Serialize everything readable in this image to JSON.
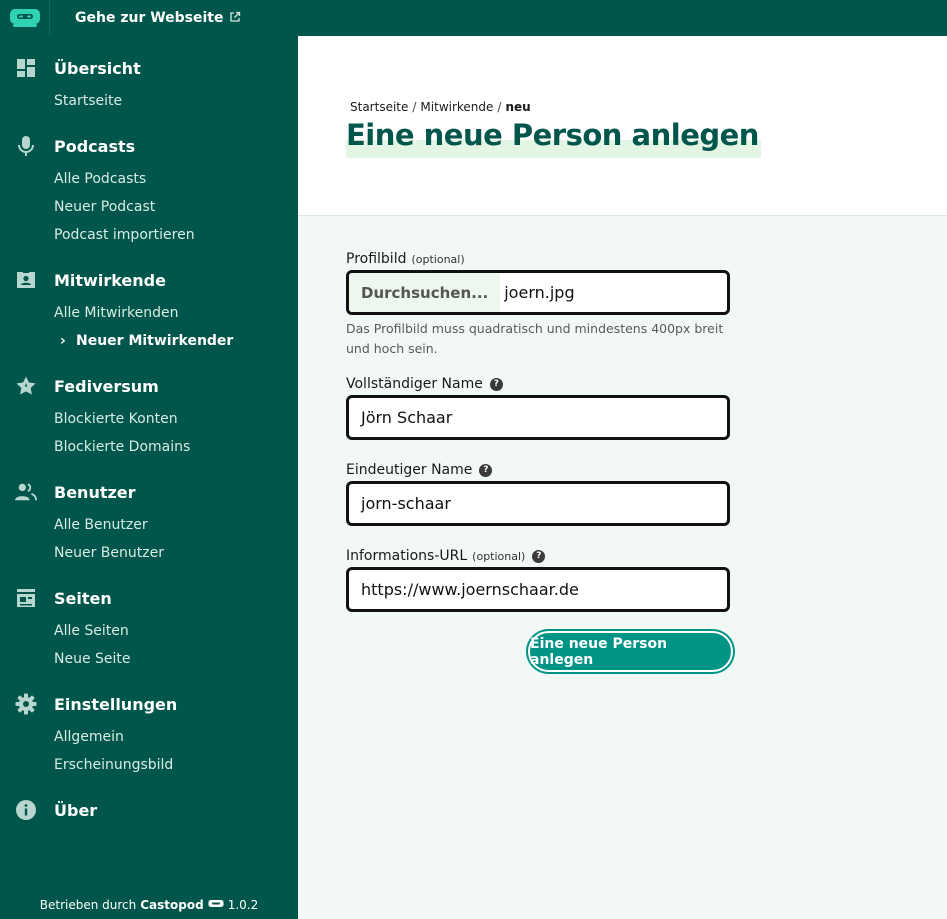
{
  "topbar": {
    "site_link": "Gehe zur Webseite"
  },
  "sidebar": {
    "sections": [
      {
        "id": "overview",
        "title": "Übersicht",
        "icon": "dashboard-icon",
        "items": [
          "Startseite"
        ]
      },
      {
        "id": "podcasts",
        "title": "Podcasts",
        "icon": "microphone-icon",
        "items": [
          "Alle Podcasts",
          "Neuer Podcast",
          "Podcast importieren"
        ]
      },
      {
        "id": "contributors",
        "title": "Mitwirkende",
        "icon": "contact-card-icon",
        "items": [
          "Alle Mitwirkenden",
          "Neuer Mitwirkender"
        ],
        "active_item": "Neuer Mitwirkender"
      },
      {
        "id": "fediverse",
        "title": "Fediversum",
        "icon": "star-icon",
        "items": [
          "Blockierte Konten",
          "Blockierte Domains"
        ]
      },
      {
        "id": "users",
        "title": "Benutzer",
        "icon": "users-icon",
        "items": [
          "Alle Benutzer",
          "Neuer Benutzer"
        ]
      },
      {
        "id": "pages",
        "title": "Seiten",
        "icon": "pages-icon",
        "items": [
          "Alle Seiten",
          "Neue Seite"
        ]
      },
      {
        "id": "settings",
        "title": "Einstellungen",
        "icon": "gear-icon",
        "items": [
          "Allgemein",
          "Erscheinungsbild"
        ]
      },
      {
        "id": "about",
        "title": "Über",
        "icon": "info-icon",
        "items": []
      }
    ],
    "footer": {
      "prefix": "Betrieben durch",
      "brand": "Castopod",
      "version": "1.0.2"
    }
  },
  "header": {
    "breadcrumb": [
      "Startseite",
      "Mitwirkende",
      "neu"
    ],
    "title": "Eine neue Person anlegen"
  },
  "form": {
    "avatar": {
      "label": "Profilbild",
      "optional": "(optional)",
      "button": "Durchsuchen...",
      "file_name": "joern.jpg",
      "hint": "Das Profilbild muss quadratisch und mindestens 400px breit und hoch sein."
    },
    "full_name": {
      "label": "Vollständiger Name",
      "value": "Jörn Schaar"
    },
    "unique_name": {
      "label": "Eindeutiger Name",
      "value": "jorn-schaar"
    },
    "info_url": {
      "label": "Informations-URL",
      "optional": "(optional)",
      "value": "https://www.joernschaar.de"
    },
    "submit": "Eine neue Person anlegen"
  },
  "colors": {
    "sidebar": "#00564a",
    "accent": "#009486",
    "background": "#f1f8f6"
  }
}
